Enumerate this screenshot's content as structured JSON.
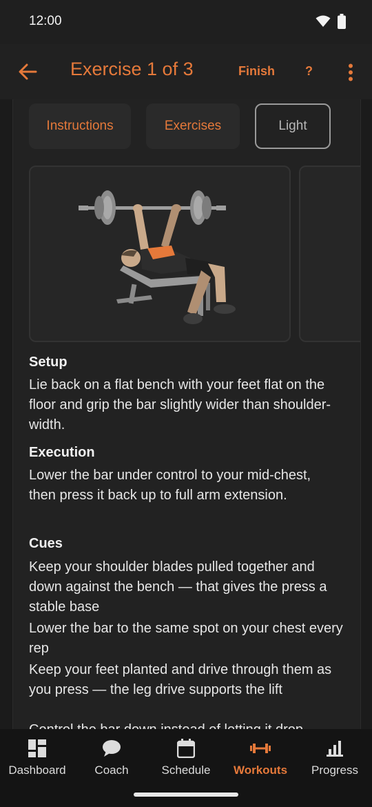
{
  "status": {
    "time": "12:00"
  },
  "appbar": {
    "title": "Exercise 1 of 3",
    "finish_label": "Finish",
    "help_label": "?"
  },
  "chips": [
    {
      "label": "Instructions"
    },
    {
      "label": "Exercises"
    },
    {
      "label": "Light"
    }
  ],
  "illustration": {
    "subject": "bench-press-icon"
  },
  "sections": {
    "setup": {
      "title": "Setup",
      "text": "Lie back on a flat bench with your feet flat on the floor and grip the bar slightly wider than shoulder-width."
    },
    "execution": {
      "title": "Execution",
      "text": "Lower the bar under control to your mid-chest, then press it back up to full arm extension."
    },
    "cues": {
      "title": "Cues",
      "items": [
        "Keep your shoulder blades pulled together and down against the bench — that gives the press a stable base",
        "Lower the bar to the same spot on your chest every rep",
        "Keep your feet planted and drive through them as you press — the leg drive supports the lift",
        "Control the bar down instead of letting it drop"
      ]
    }
  },
  "bottom_nav": {
    "items": [
      {
        "label": "Dashboard",
        "icon": "dashboard-icon"
      },
      {
        "label": "Coach",
        "icon": "chat-icon"
      },
      {
        "label": "Schedule",
        "icon": "calendar-icon"
      },
      {
        "label": "Workouts",
        "icon": "dumbbell-icon",
        "active": true
      },
      {
        "label": "Progress",
        "icon": "bar-chart-icon"
      }
    ]
  },
  "colors": {
    "accent": "#e5793a",
    "background": "#1b1b1b",
    "surface": "#222222"
  }
}
